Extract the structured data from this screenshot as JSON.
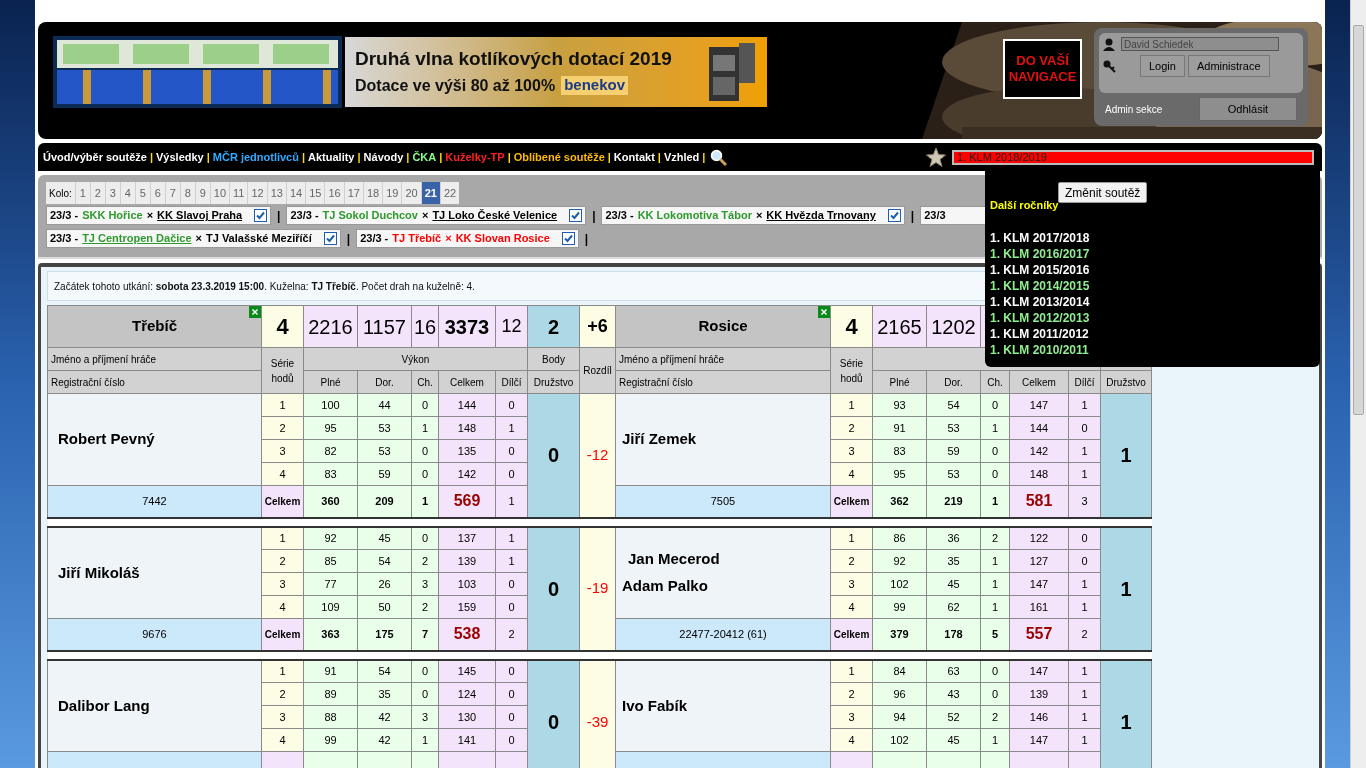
{
  "header": {
    "ad_title": "Druhá vlna kotlíkových dotací 2019",
    "ad_subtitle": "Dotace ve výši 80 až 100%",
    "ad_brand": "benekov",
    "nav_logo": [
      "DO VAŠÍ",
      "NAVIGACE"
    ],
    "login": {
      "username": "David Schiedek",
      "buttons": [
        "Login",
        "Administrace"
      ],
      "admin_label": "Admin sekce",
      "logout": "Odhlásit"
    }
  },
  "nav": {
    "items": [
      {
        "label": "Úvod/výběr soutěže",
        "color": "#ffffff"
      },
      {
        "label": "Výsledky",
        "color": "#ffffff"
      },
      {
        "label": "MČR jednotlivců",
        "color": "#33aaff"
      },
      {
        "label": "Aktuality",
        "color": "#ffffff"
      },
      {
        "label": "Návody",
        "color": "#ffffff"
      },
      {
        "label": "ČKA",
        "color": "#88ff88"
      },
      {
        "label": "Kuželky-TP",
        "color": "#ff2020"
      },
      {
        "label": "Oblíbené soutěže",
        "color": "#ffbb00"
      },
      {
        "label": "Kontakt",
        "color": "#ffffff"
      },
      {
        "label": "Vzhled",
        "color": "#ffffff"
      }
    ],
    "separator": "|",
    "competition": "1. KLM 2018/2019"
  },
  "rounds": {
    "label": "Kolo:",
    "items": [
      {
        "label": "1",
        "selected": false
      },
      {
        "label": "2",
        "selected": false
      },
      {
        "label": "3",
        "selected": false
      },
      {
        "label": "4",
        "selected": false
      },
      {
        "label": "5",
        "selected": false
      },
      {
        "label": "6",
        "selected": false
      },
      {
        "label": "7",
        "selected": false
      },
      {
        "label": "8",
        "selected": false
      },
      {
        "label": "9",
        "selected": false
      },
      {
        "label": "10",
        "selected": false
      },
      {
        "label": "11",
        "selected": false
      },
      {
        "label": "12",
        "selected": false
      },
      {
        "label": "13",
        "selected": false
      },
      {
        "label": "14",
        "selected": false
      },
      {
        "label": "15",
        "selected": false
      },
      {
        "label": "16",
        "selected": false
      },
      {
        "label": "17",
        "selected": false
      },
      {
        "label": "18",
        "selected": false
      },
      {
        "label": "19",
        "selected": false
      },
      {
        "label": "20",
        "selected": false
      },
      {
        "label": "21",
        "selected": true
      },
      {
        "label": "22",
        "selected": false
      }
    ]
  },
  "matches": [
    {
      "date": "23/3 -",
      "home": {
        "name": "SKK Hořice",
        "color": "#2e9a2e",
        "underlined": false
      },
      "sep": "×",
      "away": {
        "name": "KK Slavoj Praha",
        "color": "#000000",
        "underlined": true
      },
      "checked": true
    },
    {
      "date": "23/3 -",
      "home": {
        "name": "TJ Sokol Duchcov",
        "color": "#2e9a2e",
        "underlined": false
      },
      "sep": "×",
      "away": {
        "name": "TJ Loko České Velenice",
        "color": "#000000",
        "underlined": true
      },
      "checked": true
    },
    {
      "date": "23/3 -",
      "home": {
        "name": "KK Lokomotiva Tábor",
        "color": "#2e9a2e",
        "underlined": false
      },
      "sep": "×",
      "away": {
        "name": "KK Hvězda Trnovany",
        "color": "#000000",
        "underlined": true
      },
      "checked": true
    },
    {
      "date": "23/3"
    },
    {
      "date": "23/3 -",
      "home": {
        "name": "TJ Centropen Dačice",
        "color": "#2e9a2e",
        "underlined": true
      },
      "sep": "×",
      "away": {
        "name": "TJ Valašské Meziříčí",
        "color": "#000000",
        "underlined": false
      },
      "checked": true
    },
    {
      "date": "23/3 -",
      "home": {
        "name": "TJ Třebíč",
        "color": "#ff0000",
        "underlined": false
      },
      "sep": "×",
      "away": {
        "name": "KK Slovan Rosice",
        "color": "#ff0000",
        "underlined": false
      },
      "checked": true
    }
  ],
  "info": "Začátek tohoto utkání: **sobota 23.3.2019 15:00**. Kuželna: **TJ Třebíč**. Počet drah na kuželně: 4.",
  "summary": {
    "home": {
      "team": "Třebíč",
      "series": "4",
      "plne": "2216",
      "dor": "1157",
      "ch": "16",
      "celkem": "3373",
      "dilci": "12"
    },
    "body": "2",
    "rozdil": "+6",
    "away": {
      "team": "Rosice",
      "series": "4",
      "plne": "2165",
      "dor": "1202"
    }
  },
  "columns": {
    "home": {
      "name": "Jméno a příjmení hráče",
      "reg": "Registrační číslo",
      "series": "Série hodů",
      "vykon": "Výkon",
      "body": "Body",
      "plne": "Plné",
      "dor": "Dor.",
      "ch": "Ch.",
      "celkem": "Celkem",
      "dilci": "Dílčí",
      "druzstvo": "Družstvo"
    },
    "rozdil": "Rozdíl",
    "away": {
      "name": "Jméno a příjmení hráče",
      "reg": "Registrační číslo",
      "series": "Série hodů",
      "plne": "Plné",
      "dor": "Dor.",
      "ch": "Ch.",
      "celkem": "Celkem",
      "dilci": "Dílčí",
      "druzstvo": "Družstvo"
    }
  },
  "pairs": [
    {
      "home": {
        "names": [
          "Robert Pevný"
        ],
        "reg": "7442",
        "throws": [
          [
            "1",
            "100",
            "44",
            "0",
            "144",
            "0"
          ],
          [
            "2",
            "95",
            "53",
            "1",
            "148",
            "1"
          ],
          [
            "3",
            "82",
            "53",
            "0",
            "135",
            "0"
          ],
          [
            "4",
            "83",
            "59",
            "0",
            "142",
            "0"
          ]
        ],
        "total": [
          "Celkem",
          "360",
          "209",
          "1",
          "569",
          "1"
        ]
      },
      "home_points": "0",
      "diff": "-12",
      "away": {
        "names": [
          "Jiří Zemek"
        ],
        "reg": "7505",
        "throws": [
          [
            "1",
            "93",
            "54",
            "0",
            "147",
            "1"
          ],
          [
            "2",
            "91",
            "53",
            "1",
            "144",
            "0"
          ],
          [
            "3",
            "83",
            "59",
            "0",
            "142",
            "1"
          ],
          [
            "4",
            "95",
            "53",
            "0",
            "148",
            "1"
          ]
        ],
        "total": [
          "Celkem",
          "362",
          "219",
          "1",
          "581",
          "3"
        ]
      },
      "away_points": "1"
    },
    {
      "home": {
        "names": [
          "Jiří Mikoláš"
        ],
        "reg": "9676",
        "throws": [
          [
            "1",
            "92",
            "45",
            "0",
            "137",
            "1"
          ],
          [
            "2",
            "85",
            "54",
            "2",
            "139",
            "1"
          ],
          [
            "3",
            "77",
            "26",
            "3",
            "103",
            "0"
          ],
          [
            "4",
            "109",
            "50",
            "2",
            "159",
            "0"
          ]
        ],
        "total": [
          "Celkem",
          "363",
          "175",
          "7",
          "538",
          "2"
        ]
      },
      "home_points": "0",
      "diff": "-19",
      "away": {
        "names": [
          "Jan Mecerod",
          "Adam Palko"
        ],
        "reg": "22477-20412 (61)",
        "throws": [
          [
            "1",
            "86",
            "36",
            "2",
            "122",
            "0"
          ],
          [
            "2",
            "92",
            "35",
            "1",
            "127",
            "0"
          ],
          [
            "3",
            "102",
            "45",
            "1",
            "147",
            "1"
          ],
          [
            "4",
            "99",
            "62",
            "1",
            "161",
            "1"
          ]
        ],
        "total": [
          "Celkem",
          "379",
          "178",
          "5",
          "557",
          "2"
        ]
      },
      "away_points": "1"
    },
    {
      "home": {
        "names": [
          "Dalibor Lang"
        ],
        "throws": [
          [
            "1",
            "91",
            "54",
            "0",
            "145",
            "0"
          ],
          [
            "2",
            "89",
            "35",
            "0",
            "124",
            "0"
          ],
          [
            "3",
            "88",
            "42",
            "3",
            "130",
            "0"
          ],
          [
            "4",
            "99",
            "42",
            "1",
            "141",
            "0"
          ]
        ]
      },
      "home_points": "0",
      "diff": "-39",
      "away": {
        "names": [
          "Ivo Fabík"
        ],
        "throws": [
          [
            "1",
            "84",
            "63",
            "0",
            "147",
            "1"
          ],
          [
            "2",
            "96",
            "43",
            "0",
            "139",
            "1"
          ],
          [
            "3",
            "94",
            "52",
            "2",
            "146",
            "1"
          ],
          [
            "4",
            "102",
            "45",
            "1",
            "147",
            "1"
          ]
        ]
      },
      "away_points": "1"
    }
  ],
  "dropdown": {
    "button": "Změnit soutěž",
    "title": "Další ročníky",
    "seasons": [
      {
        "label": "1. KLM 2017/2018",
        "color": "#ffffff"
      },
      {
        "label": "1. KLM 2016/2017",
        "color": "#90ee90"
      },
      {
        "label": "1. KLM 2015/2016",
        "color": "#ffffff"
      },
      {
        "label": "1. KLM 2014/2015",
        "color": "#90ee90"
      },
      {
        "label": "1. KLM 2013/2014",
        "color": "#ffffff"
      },
      {
        "label": "1. KLM 2012/2013",
        "color": "#90ee90"
      },
      {
        "label": "1. KLM 2011/2012",
        "color": "#ffffff"
      },
      {
        "label": "1. KLM 2010/2011",
        "color": "#90ee90"
      }
    ]
  }
}
